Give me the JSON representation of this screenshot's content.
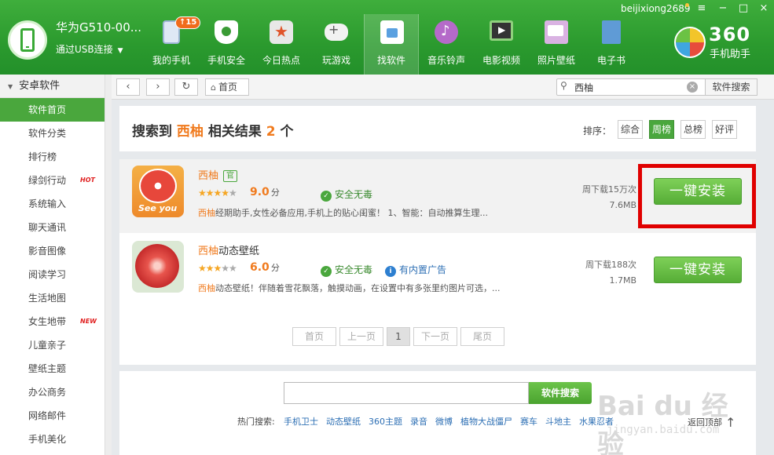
{
  "header": {
    "device_name": "华为G510-00...",
    "connection": "通过USB连接",
    "username": "beijixiong2689",
    "nav": [
      {
        "label": "我的手机",
        "icon": "phone-icon",
        "badge": "15"
      },
      {
        "label": "手机安全",
        "icon": "shield-icon"
      },
      {
        "label": "今日热点",
        "icon": "hot-news-icon"
      },
      {
        "label": "玩游戏",
        "icon": "gamepad-icon"
      },
      {
        "label": "找软件",
        "icon": "app-store-icon",
        "active": true
      },
      {
        "label": "音乐铃声",
        "icon": "music-icon"
      },
      {
        "label": "电影视频",
        "icon": "video-icon"
      },
      {
        "label": "照片壁纸",
        "icon": "wallpaper-icon"
      },
      {
        "label": "电子书",
        "icon": "ebook-icon"
      }
    ],
    "window_controls": {
      "menu": "≡",
      "minimize": "−",
      "maximize": "□",
      "close": "×"
    },
    "logo": {
      "brand": "360",
      "sub": "手机助手"
    }
  },
  "sidebar": {
    "title": "安卓软件",
    "items": [
      {
        "label": "软件首页",
        "active": true
      },
      {
        "label": "软件分类"
      },
      {
        "label": "排行榜"
      },
      {
        "label": "绿剑行动",
        "tag": "HOT"
      },
      {
        "label": "系统输入"
      },
      {
        "label": "聊天通讯"
      },
      {
        "label": "影音图像"
      },
      {
        "label": "阅读学习"
      },
      {
        "label": "生活地图"
      },
      {
        "label": "女生地带",
        "tag": "NEW"
      },
      {
        "label": "儿童亲子"
      },
      {
        "label": "壁纸主题"
      },
      {
        "label": "办公商务"
      },
      {
        "label": "网络邮件"
      },
      {
        "label": "手机美化"
      }
    ]
  },
  "toolbar": {
    "back": "‹",
    "forward": "›",
    "refresh": "↻",
    "home_label": "首页",
    "search_value": "西柚",
    "search_button": "软件搜索"
  },
  "result_header": {
    "prefix": "搜索到",
    "keyword": "西柚",
    "middle": "相关结果",
    "count": "2",
    "suffix": "个",
    "sort_label": "排序：",
    "sort_options": [
      {
        "label": "综合"
      },
      {
        "label": "周榜",
        "active": true
      },
      {
        "label": "总榜"
      },
      {
        "label": "好评"
      }
    ]
  },
  "apps": [
    {
      "name_hl": "西柚",
      "name_rest": "",
      "official_badge": "官",
      "stars_on": "★★★★",
      "stars_off": "★",
      "score": "9.0",
      "score_unit": "分",
      "safe": "安全无毒",
      "desc_hl": "西柚",
      "desc_rest": "经期助手,女性必备应用,手机上的贴心闺蜜！  1、智能：自动推算生理...",
      "downloads": "周下载15万次",
      "size": "7.6MB",
      "install": "一键安装"
    },
    {
      "name_hl": "西柚",
      "name_rest": "动态壁纸",
      "stars_on": "★★★",
      "stars_off": "★★",
      "score": "6.0",
      "score_unit": "分",
      "safe": "安全无毒",
      "ad_info": "有内置广告",
      "desc_hl": "西柚",
      "desc_rest": "动态壁纸！伴随着雪花飘落，触摸动画，在设置中有多张里约图片可选，...",
      "downloads": "周下载188次",
      "size": "1.7MB",
      "install": "一键安装"
    }
  ],
  "pager": {
    "first": "首页",
    "prev": "上一页",
    "current": "1",
    "next": "下一页",
    "last": "尾页"
  },
  "bottom": {
    "search_button": "软件搜索",
    "hot_label": "热门搜索:",
    "hot": [
      "手机卫士",
      "动态壁纸",
      "360主题",
      "录音",
      "微博",
      "植物大战僵尸",
      "赛车",
      "斗地主",
      "水果忍者"
    ],
    "back_top": "返回顶部"
  },
  "watermark": {
    "main": "Bai du 经验",
    "sub": "jingyan.baidu.com"
  },
  "colors": {
    "brand_green": "#2e9c2f",
    "accent_orange": "#f07a1d",
    "highlight_red": "#e00000"
  }
}
